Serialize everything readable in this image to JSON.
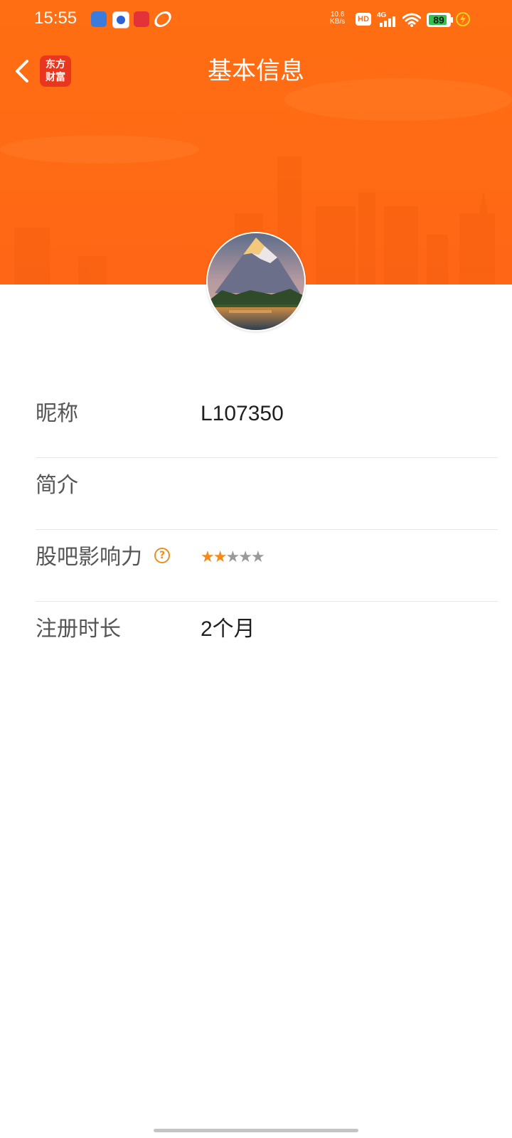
{
  "status_bar": {
    "time": "15:55",
    "net_rate_value": "10.6",
    "net_rate_unit": "KB/s",
    "hd_label": "HD",
    "network": "4G",
    "battery_level": "89"
  },
  "nav": {
    "logo_line1": "东方",
    "logo_line2": "财富",
    "title": "基本信息"
  },
  "profile": {
    "rows": [
      {
        "label": "昵称",
        "value": "L107350"
      },
      {
        "label": "简介",
        "value": ""
      },
      {
        "label": "股吧影响力",
        "help_icon": "?",
        "rating": 2,
        "rating_max": 5
      },
      {
        "label": "注册时长",
        "value": "2个月"
      }
    ]
  },
  "colors": {
    "header_orange": "#ff6a14",
    "star_on": "#f08b1c",
    "star_off": "#9a9a9a",
    "help_icon": "#e98f22"
  },
  "icons": [
    "back-arrow-icon",
    "help-circle-icon",
    "star-icon",
    "wifi-icon",
    "signal-icon",
    "battery-icon",
    "charging-icon"
  ]
}
